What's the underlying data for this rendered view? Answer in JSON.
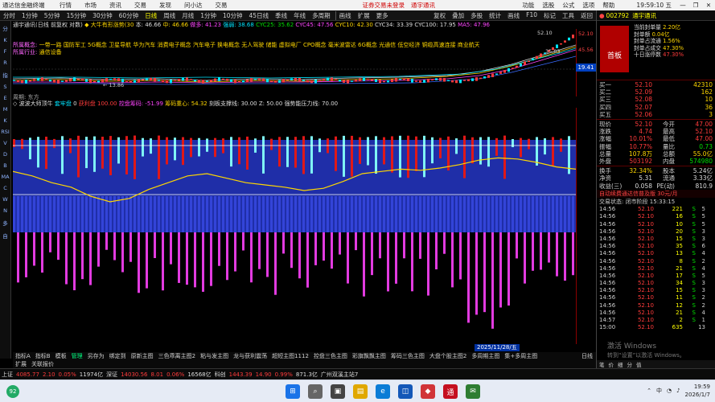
{
  "window": {
    "title": "通达信金融终端",
    "menus": [
      "行情",
      "市场",
      "资讯",
      "交易",
      "发现",
      "问小达",
      "交易"
    ],
    "alerts": [
      "证券交易未登录",
      "通宇通讯"
    ],
    "right_menus": [
      "功能",
      "选股",
      "公式",
      "选项",
      "帮助"
    ],
    "clock": "19:59:10 五",
    "controls": [
      "—",
      "❐",
      "✕"
    ]
  },
  "toolbar": {
    "periods": [
      "分时",
      "1分钟",
      "5分钟",
      "15分钟",
      "30分钟",
      "60分钟",
      "日线",
      "周线",
      "月线",
      "1分钟",
      "10分钟",
      "45日线",
      "季线",
      "年线",
      "多周期"
    ],
    "active_period": "日线",
    "extras": [
      "画线",
      "扩展",
      "更多"
    ],
    "right": [
      "复权",
      "叠加",
      "多股",
      "统计",
      "画线",
      "F10",
      "标记",
      "工具",
      "返回"
    ]
  },
  "leftbar": [
    "分",
    "K",
    "F",
    "R",
    "指",
    "S",
    "E",
    "M",
    "K",
    "RSI",
    "V",
    "D",
    "B",
    "MA",
    "C",
    "W",
    "N",
    "多",
    "自"
  ],
  "main_header": {
    "name": "通宇通讯(日线 前复权 对数)",
    "indicator": "◆ 大牛有形涨势(30",
    "items": [
      {
        "t": "本: 46.66",
        "c": "c-white"
      },
      {
        "t": "中: 46.66",
        "c": "c-yel"
      },
      {
        "t": "做多: 41.23",
        "c": "c-mag"
      },
      {
        "t": "强弱: 38.68",
        "c": "c-cyn"
      },
      {
        "t": "CYC25: 35.62",
        "c": "c-grn"
      },
      {
        "t": "CYC45: 47.56",
        "c": "c-mag"
      },
      {
        "t": "CYC10: 42.30",
        "c": "c-yel"
      },
      {
        "t": "CYC34: 33.39",
        "c": "c-white"
      },
      {
        "t": "CYC100: 17.95",
        "c": "c-white"
      },
      {
        "t": "MA5: 47.96",
        "c": "c-mag"
      }
    ]
  },
  "concepts": {
    "label": "所属概念:",
    "text": "一带一路 国防军工 5G概念 卫星导航 华为汽车 消费电子概念 汽车电子 换电概念 无人驾驶 储能 虚拟电厂 CPO概念 毫米波雷达 6G概念 光通信 低空经济 铜缆高速连接 商业航天"
  },
  "industry": {
    "label": "所属行业:",
    "text": "通信设备"
  },
  "main_chart": {
    "y_labels": [
      "52.10",
      "45.56"
    ],
    "current_price": "19.41",
    "annotations": [
      "52.10",
      "35.83",
      "13.86"
    ],
    "row_label": "周期: 东方"
  },
  "indicator_header": {
    "name": "◇ 波波大师顶牛",
    "items": [
      {
        "t": "套牢盘",
        "c": "c-cyn"
      },
      {
        "t": "0",
        "c": "c-white"
      },
      {
        "t": "获利盘",
        "c": "c-red"
      },
      {
        "t": "100.00",
        "c": "c-red"
      },
      {
        "t": "控盘筹码: -51.99",
        "c": "c-mag"
      },
      {
        "t": "筹码重心: 54.32",
        "c": "c-yel"
      },
      {
        "t": "刻板支撑线: 30.00",
        "c": "c-white"
      },
      {
        "t": "Z: 50.00",
        "c": "c-white"
      },
      {
        "t": "强势能压力线: 70.00",
        "c": "c-white"
      }
    ]
  },
  "indicator_chart": {
    "date_label": "2025/11/28/五",
    "line_levels": {
      "upper": 70,
      "middle": 50,
      "lower": 30
    },
    "markers": [
      "减",
      "踢",
      "冻",
      "漫"
    ],
    "bar_heights": [
      0.9,
      0.4,
      0.6,
      0.9,
      0.5,
      0.3,
      0.7,
      0.4,
      0.6,
      0.8,
      0.2,
      0.5,
      0.7,
      0.4,
      0.6,
      0.3,
      0.5,
      0.8,
      0.6,
      0.4
    ],
    "gold_line": [
      0.72,
      0.68,
      0.62,
      0.58,
      0.5,
      0.45,
      0.48,
      0.56,
      0.62,
      0.68,
      0.7,
      0.66,
      0.62,
      0.6,
      0.58,
      0.55,
      0.57,
      0.63,
      0.7,
      0.72,
      0.74,
      0.73,
      0.75,
      0.78,
      0.82,
      0.84,
      0.83,
      0.8,
      0.76,
      0.74
    ]
  },
  "tabs": [
    "指标A",
    "指标B",
    "模板",
    "管理",
    "另存为",
    "绑定到",
    "原新主图",
    "三色乖离主图2",
    "粘与发主图",
    "龙与获利震荡",
    "超短主图1112",
    "控盘三色主图",
    "彩旗飘飘主图",
    "筹码三色主图",
    "大盘个股主图2",
    "多周期主图",
    "集+多周主图"
  ],
  "active_tab": "管理",
  "tabs_right": "日线",
  "tabs2": [
    "扩展",
    "关联报价"
  ],
  "right_panel": {
    "code": "002792",
    "name": "通宇通讯",
    "board": "首板",
    "feng": [
      {
        "k": "当前封单量",
        "v": "2.20亿",
        "c": "c-yel"
      },
      {
        "k": "封单额",
        "v": "0.04亿",
        "c": "c-yel"
      },
      {
        "k": "封单占流通",
        "v": "1.56%",
        "c": "c-yel"
      },
      {
        "k": "封单占成交",
        "v": "47.30%",
        "c": "c-yel"
      },
      {
        "k": "十日涨停数",
        "v": "47.30%",
        "c": "c-red"
      }
    ],
    "asks": [
      {
        "k": "买一",
        "p": "52.10",
        "q": "42310"
      },
      {
        "k": "买二",
        "p": "52.09",
        "q": "162"
      },
      {
        "k": "买三",
        "p": "52.08",
        "q": "10"
      },
      {
        "k": "买四",
        "p": "52.07",
        "q": "36"
      },
      {
        "k": "买五",
        "p": "52.06",
        "q": "3"
      }
    ],
    "quote": [
      {
        "k": "现价",
        "v": "52.10",
        "k2": "今开",
        "v2": "47.00"
      },
      {
        "k": "涨跌",
        "v": "4.74",
        "k2": "最高",
        "v2": "52.10"
      },
      {
        "k": "涨幅",
        "v": "10.01%",
        "k2": "最低",
        "v2": "47.00"
      },
      {
        "k": "振幅",
        "v": "10.77%",
        "k2": "量比",
        "v2": "0.73"
      },
      {
        "k": "总量",
        "v": "107.8万",
        "k2": "总额",
        "v2": "55.0亿"
      },
      {
        "k": "外盘",
        "v": "503192",
        "k2": "内盘",
        "v2": "574980"
      },
      {
        "k": "换手",
        "v": "32.34%",
        "k2": "股本",
        "v2": "5.24亿"
      },
      {
        "k": "净资",
        "v": "5.31",
        "k2": "流通",
        "v2": "3.33亿"
      },
      {
        "k": "收益(三)",
        "v": "0.058",
        "k2": "PE(动)",
        "v2": "810.9"
      }
    ],
    "promo": "自动续费通达信普及版 30元/月",
    "status": "交易状态: 闭市阶段 15:33:15",
    "trades": [
      {
        "t": "14:56",
        "p": "52.10",
        "q": "221",
        "s": "S",
        "n": "5"
      },
      {
        "t": "14:56",
        "p": "52.10",
        "q": "16",
        "s": "S",
        "n": "5"
      },
      {
        "t": "14:56",
        "p": "52.10",
        "q": "10",
        "s": "S",
        "n": "5"
      },
      {
        "t": "14:56",
        "p": "52.10",
        "q": "20",
        "s": "S",
        "n": "3"
      },
      {
        "t": "14:56",
        "p": "52.10",
        "q": "15",
        "s": "S",
        "n": "3"
      },
      {
        "t": "14:56",
        "p": "52.10",
        "q": "35",
        "s": "S",
        "n": "6"
      },
      {
        "t": "14:56",
        "p": "52.10",
        "q": "13",
        "s": "S",
        "n": "4"
      },
      {
        "t": "14:56",
        "p": "52.10",
        "q": "8",
        "s": "S",
        "n": "2"
      },
      {
        "t": "14:56",
        "p": "52.10",
        "q": "21",
        "s": "S",
        "n": "4"
      },
      {
        "t": "14:56",
        "p": "52.10",
        "q": "17",
        "s": "S",
        "n": "5"
      },
      {
        "t": "14:56",
        "p": "52.10",
        "q": "34",
        "s": "S",
        "n": "3"
      },
      {
        "t": "14:56",
        "p": "52.10",
        "q": "15",
        "s": "S",
        "n": "3"
      },
      {
        "t": "14:56",
        "p": "52.10",
        "q": "11",
        "s": "S",
        "n": "2"
      },
      {
        "t": "14:56",
        "p": "52.10",
        "q": "12",
        "s": "S",
        "n": "2"
      },
      {
        "t": "14:56",
        "p": "52.10",
        "q": "21",
        "s": "S",
        "n": "4"
      },
      {
        "t": "14:57",
        "p": "52.10",
        "q": "2",
        "s": "S",
        "n": "1"
      },
      {
        "t": "15:00",
        "p": "52.10",
        "q": "635",
        "s": "",
        "n": "13"
      }
    ],
    "footer": [
      "笔",
      "价",
      "细",
      "分",
      "值"
    ]
  },
  "watermark": {
    "line1": "激活 Windows",
    "line2": "转到“设置”以激活 Windows。"
  },
  "indexbar": [
    {
      "t": "上证",
      "c": "c-white"
    },
    {
      "t": "4085.77",
      "c": "c-red"
    },
    {
      "t": "2.10",
      "c": "c-red"
    },
    {
      "t": "0.05%",
      "c": "c-red"
    },
    {
      "t": "11974亿",
      "c": "c-white"
    },
    {
      "t": "深证",
      "c": "c-white"
    },
    {
      "t": "14030.56",
      "c": "c-red"
    },
    {
      "t": "8.01",
      "c": "c-red"
    },
    {
      "t": "0.06%",
      "c": "c-red"
    },
    {
      "t": "16568亿",
      "c": "c-white"
    },
    {
      "t": "科创",
      "c": "c-white"
    },
    {
      "t": "1443.39",
      "c": "c-red"
    },
    {
      "t": "14.90",
      "c": "c-red"
    },
    {
      "t": "0.99%",
      "c": "c-red"
    },
    {
      "t": "871.3亿",
      "c": "c-white"
    },
    {
      "t": "广州双溪主站7",
      "c": "c-white"
    }
  ],
  "taskbar": {
    "icons": [
      "windows-start",
      "search",
      "task-view",
      "explorer",
      "edge",
      "store",
      "mail",
      "app1",
      "app2"
    ],
    "clock": "19:59",
    "date": "2026/1/7",
    "badge": "92"
  }
}
